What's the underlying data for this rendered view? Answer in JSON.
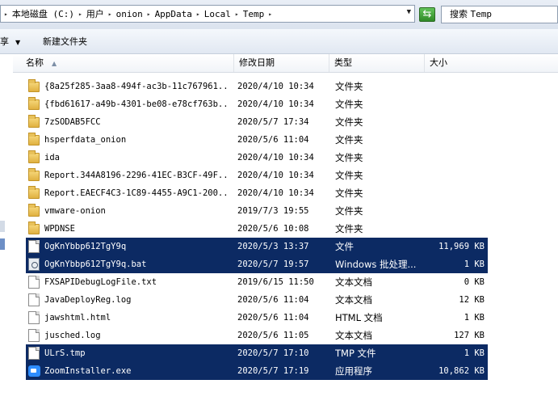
{
  "address_bar": {
    "crumbs": [
      "本地磁盘 (C:)",
      "用户",
      "onion",
      "AppData",
      "Local",
      "Temp"
    ],
    "search_placeholder_prefix": "搜索",
    "search_placeholder_target": "Temp"
  },
  "toolbar": {
    "share_label": "共享",
    "new_folder_label": "新建文件夹"
  },
  "columns": {
    "name": "名称",
    "date": "修改日期",
    "type": "类型",
    "size": "大小"
  },
  "files": [
    {
      "name": "{8a25f285-3aa8-494f-ac3b-11c767961...",
      "date": "2020/4/10 10:34",
      "type": "文件夹",
      "size": "",
      "icon": "folder-icon",
      "selected": false
    },
    {
      "name": "{fbd61617-a49b-4301-be08-e78cf763b...",
      "date": "2020/4/10 10:34",
      "type": "文件夹",
      "size": "",
      "icon": "folder-icon",
      "selected": false
    },
    {
      "name": "7zSODAB5FCC",
      "date": "2020/5/7 17:34",
      "type": "文件夹",
      "size": "",
      "icon": "folder-icon",
      "selected": false
    },
    {
      "name": "hsperfdata_onion",
      "date": "2020/5/6 11:04",
      "type": "文件夹",
      "size": "",
      "icon": "folder-icon",
      "selected": false
    },
    {
      "name": "ida",
      "date": "2020/4/10 10:34",
      "type": "文件夹",
      "size": "",
      "icon": "folder-icon",
      "selected": false
    },
    {
      "name": "Report.344A8196-2296-41EC-B3CF-49F...",
      "date": "2020/4/10 10:34",
      "type": "文件夹",
      "size": "",
      "icon": "folder-icon",
      "selected": false
    },
    {
      "name": "Report.EAECF4C3-1C89-4455-A9C1-200...",
      "date": "2020/4/10 10:34",
      "type": "文件夹",
      "size": "",
      "icon": "folder-icon",
      "selected": false
    },
    {
      "name": "vmware-onion",
      "date": "2019/7/3 19:55",
      "type": "文件夹",
      "size": "",
      "icon": "folder-icon",
      "selected": false
    },
    {
      "name": "WPDNSE",
      "date": "2020/5/6 10:08",
      "type": "文件夹",
      "size": "",
      "icon": "folder-icon",
      "selected": false
    },
    {
      "name": "OgKnYbbp612TgY9q",
      "date": "2020/5/3 13:37",
      "type": "文件",
      "size": "11,969 KB",
      "icon": "file-icon",
      "selected": true
    },
    {
      "name": "OgKnYbbp612TgY9q.bat",
      "date": "2020/5/7 19:57",
      "type": "Windows 批处理...",
      "size": "1 KB",
      "icon": "batch-file-icon",
      "selected": true
    },
    {
      "name": "FXSAPIDebugLogFile.txt",
      "date": "2019/6/15 11:50",
      "type": "文本文档",
      "size": "0 KB",
      "icon": "text-file-icon",
      "selected": false
    },
    {
      "name": "JavaDeployReg.log",
      "date": "2020/5/6 11:04",
      "type": "文本文档",
      "size": "12 KB",
      "icon": "text-file-icon",
      "selected": false
    },
    {
      "name": "jawshtml.html",
      "date": "2020/5/6 11:04",
      "type": "HTML 文档",
      "size": "1 KB",
      "icon": "html-file-icon",
      "selected": false
    },
    {
      "name": "jusched.log",
      "date": "2020/5/6 11:05",
      "type": "文本文档",
      "size": "127 KB",
      "icon": "text-file-icon",
      "selected": false
    },
    {
      "name": "ULrS.tmp",
      "date": "2020/5/7 17:10",
      "type": "TMP 文件",
      "size": "1 KB",
      "icon": "file-icon",
      "selected": true
    },
    {
      "name": "ZoomInstaller.exe",
      "date": "2020/5/7 17:19",
      "type": "应用程序",
      "size": "10,862 KB",
      "icon": "zoom-app-icon",
      "selected": true
    }
  ],
  "colors": {
    "selection": "#0c2a63",
    "folder": "#e0b141",
    "refresh": "#2f8a27",
    "zoom": "#2d8cff"
  }
}
